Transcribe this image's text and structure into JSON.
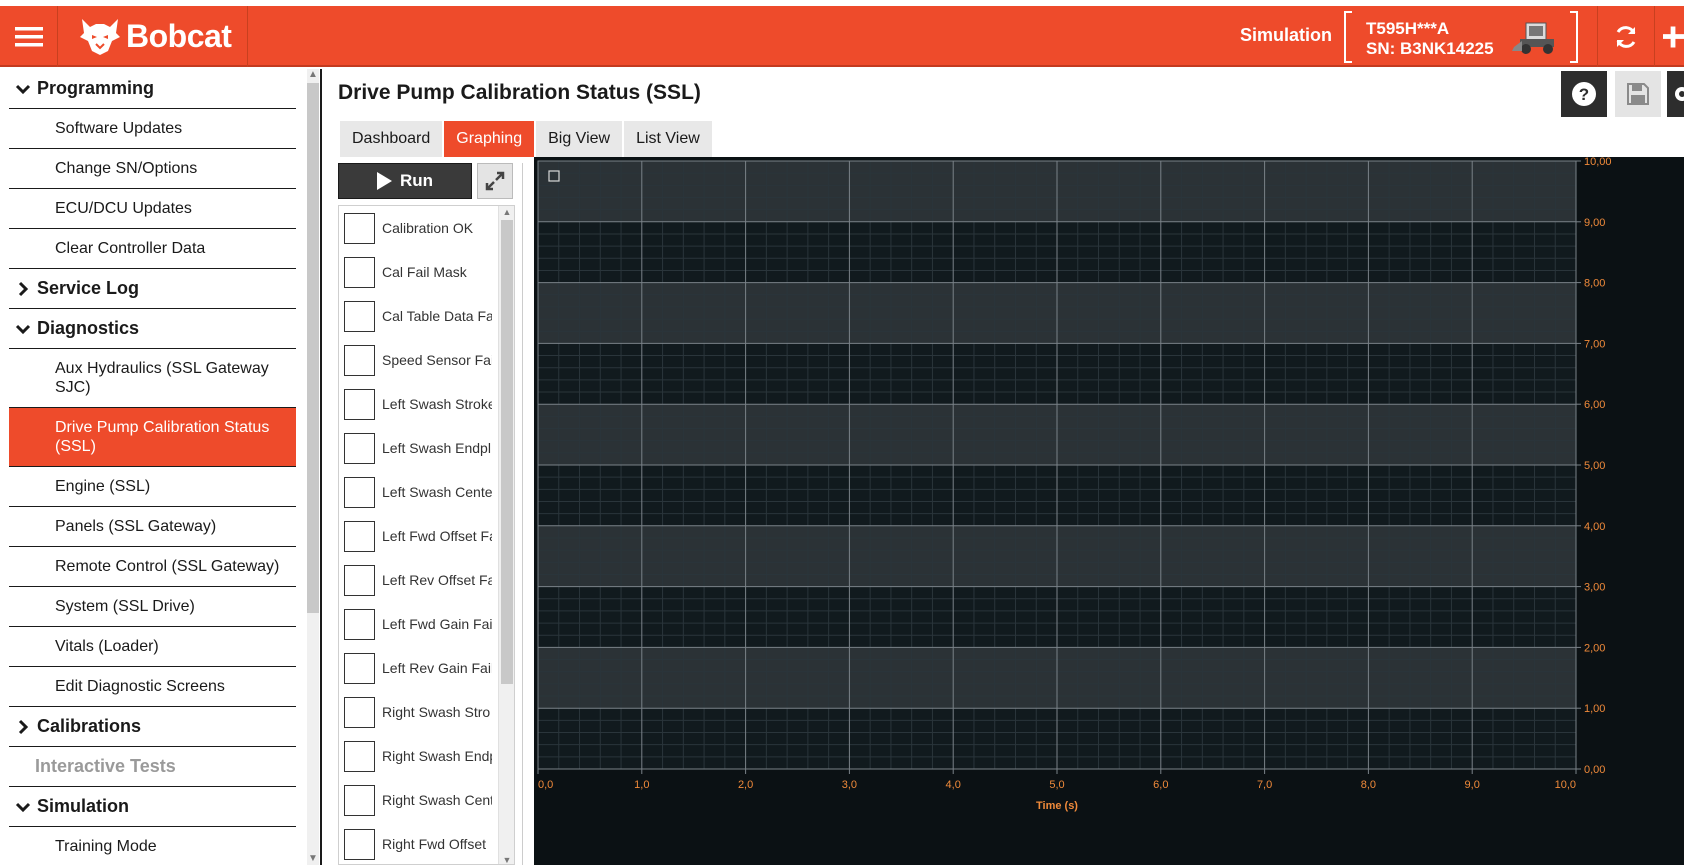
{
  "app": {
    "brand": "Bobcat",
    "mode_label": "Simulation",
    "machine_model": "T595H***A",
    "machine_sn": "SN: B3NK14225"
  },
  "sidebar": {
    "sections": [
      {
        "label": "Programming",
        "state": "expanded",
        "items": [
          "Software Updates",
          "Change SN/Options",
          "ECU/DCU Updates",
          "Clear Controller Data"
        ]
      },
      {
        "label": "Service Log",
        "state": "collapsed",
        "items": []
      },
      {
        "label": "Diagnostics",
        "state": "expanded",
        "items": [
          "Aux Hydraulics (SSL Gateway SJC)",
          "Drive Pump Calibration Status (SSL)",
          "Engine (SSL)",
          "Panels (SSL Gateway)",
          "Remote Control (SSL Gateway)",
          "System (SSL Drive)",
          "Vitals (Loader)",
          "Edit Diagnostic Screens"
        ]
      },
      {
        "label": "Calibrations",
        "state": "collapsed",
        "items": []
      },
      {
        "label": "Interactive Tests",
        "state": "disabled",
        "items": []
      },
      {
        "label": "Simulation",
        "state": "expanded",
        "items": [
          "Training Mode"
        ]
      }
    ],
    "active_item": "Drive Pump Calibration Status (SSL)"
  },
  "main": {
    "title": "Drive Pump Calibration Status (SSL)",
    "tabs": [
      "Dashboard",
      "Graphing",
      "Big View",
      "List View"
    ],
    "active_tab": "Graphing",
    "run_label": "Run",
    "signals": [
      "Calibration OK",
      "Cal Fail Mask",
      "Cal Table Data Fa",
      "Speed Sensor Fai",
      "Left Swash Stroke",
      "Left Swash Endpl",
      "Left Swash Cente",
      "Left Fwd Offset Fa",
      "Left Rev Offset Fa",
      "Left Fwd Gain Fai",
      "Left Rev Gain Fail",
      "Right Swash Stro",
      "Right Swash Endp",
      "Right Swash Cent",
      "Right Fwd Offset"
    ]
  },
  "chart_data": {
    "type": "line",
    "title": "",
    "xlabel": "Time (s)",
    "ylabel": "",
    "xlim": [
      0,
      10
    ],
    "ylim": [
      0,
      10
    ],
    "x_ticks": [
      "0,0",
      "1,0",
      "2,0",
      "3,0",
      "4,0",
      "5,0",
      "6,0",
      "7,0",
      "8,0",
      "9,0",
      "10,0"
    ],
    "y_ticks": [
      "0,00",
      "1,00",
      "2,00",
      "3,00",
      "4,00",
      "5,00",
      "6,00",
      "7,00",
      "8,00",
      "9,00",
      "10,00"
    ],
    "series": [],
    "grid": true,
    "colors": {
      "background": "#0b1114",
      "band_light": "#2b3236",
      "band_dark": "#111a1e",
      "major_grid": "#7a8288",
      "tick_label": "#f08a3a"
    }
  }
}
